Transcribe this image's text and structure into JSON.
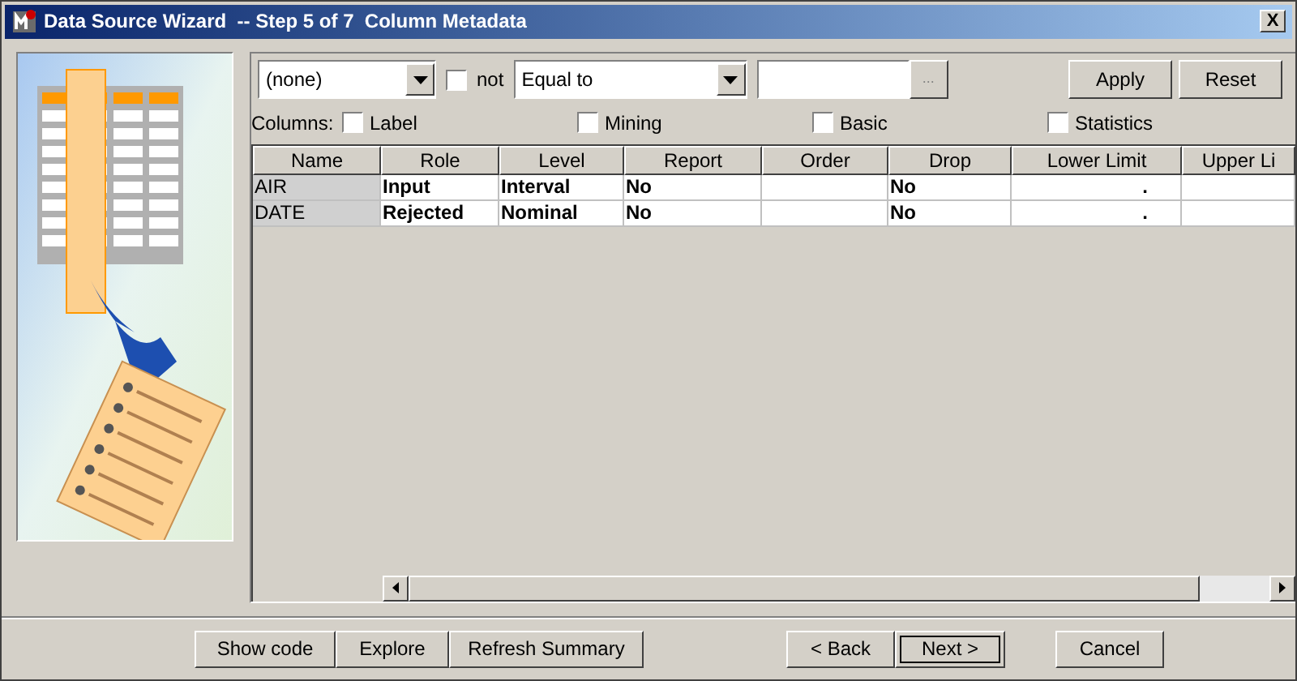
{
  "window": {
    "title": "Data Source Wizard  -- Step 5 of 7  Column Metadata",
    "close": "X"
  },
  "filter": {
    "column_select": "(none)",
    "not_checked": false,
    "not_label": "not",
    "operator_select": "Equal to",
    "browse": "...",
    "buttons": [
      "Apply",
      "Reset"
    ]
  },
  "columns_options": {
    "label": "Columns:",
    "options": [
      {
        "label": "Label",
        "checked": false
      },
      {
        "label": "Mining",
        "checked": false
      },
      {
        "label": "Basic",
        "checked": false
      },
      {
        "label": "Statistics",
        "checked": false
      }
    ]
  },
  "table": {
    "columns": [
      "Name",
      "Role",
      "Level",
      "Report",
      "Order",
      "Drop",
      "Lower Limit",
      "Upper Li"
    ],
    "rows": [
      [
        "AIR",
        "Input",
        "Interval",
        "No",
        "",
        "No",
        ".",
        ""
      ],
      [
        "DATE",
        "Rejected",
        "Nominal",
        "No",
        "",
        "No",
        ".",
        ""
      ]
    ]
  },
  "footer_buttons": [
    {
      "label": "Show code",
      "focused": false
    },
    {
      "label": "Explore",
      "focused": false
    },
    {
      "label": "Refresh Summary",
      "focused": false
    },
    {
      "label": "< Back",
      "focused": false
    },
    {
      "label": "Next >",
      "focused": true
    },
    {
      "label": "Cancel",
      "focused": false
    }
  ]
}
